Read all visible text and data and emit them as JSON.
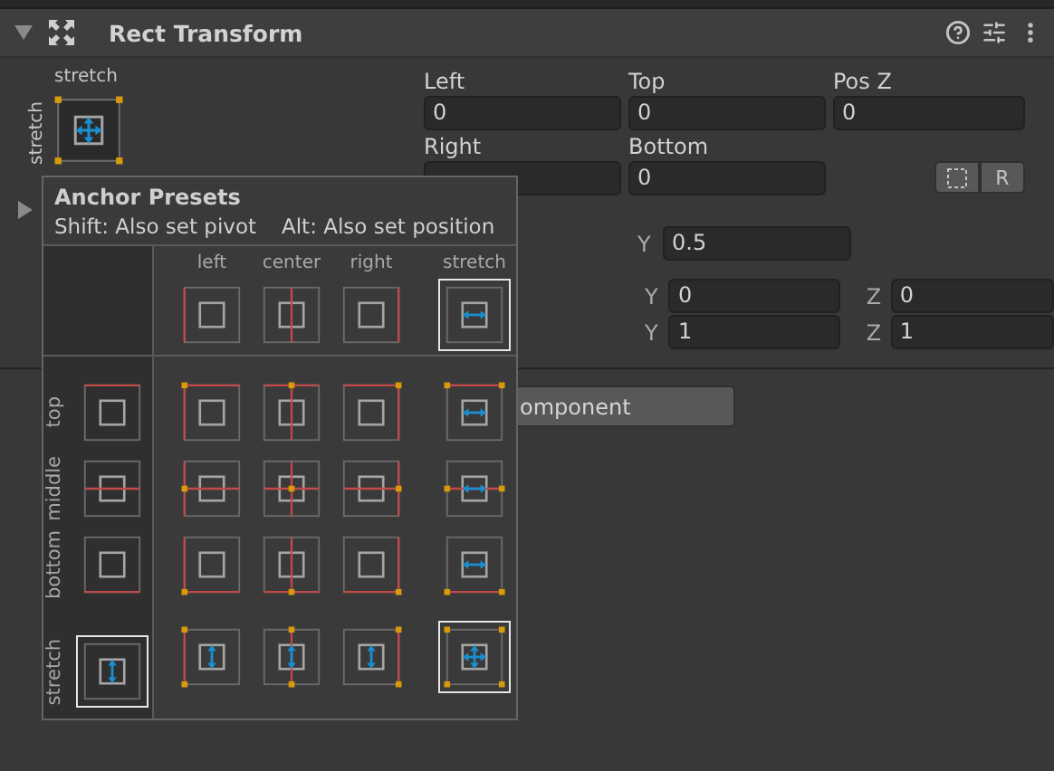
{
  "component": {
    "title": "Rect Transform",
    "expanded": true
  },
  "anchor": {
    "top_label": "stretch",
    "side_label": "stretch",
    "kind": "stretch_stretch"
  },
  "offset_fields": [
    {
      "label": "Left",
      "value": "0"
    },
    {
      "label": "Top",
      "value": "0"
    },
    {
      "label": "Pos Z",
      "value": "0"
    },
    {
      "label": "Right"
    },
    {
      "label": "Bottom",
      "value": "0"
    }
  ],
  "raw_button": "R",
  "pivot_row": [
    {
      "axis": "Y",
      "value": "0.5"
    }
  ],
  "rotation_row": [
    {
      "axis": "Y",
      "value": "0"
    },
    {
      "axis": "Z",
      "value": "0"
    }
  ],
  "scale_row": [
    {
      "axis": "Y",
      "value": "1"
    },
    {
      "axis": "Z",
      "value": "1"
    }
  ],
  "add_component_button": "omponent",
  "popup": {
    "title": "Anchor Presets",
    "hint_shift": "Shift: Also set pivot",
    "hint_alt": "Alt: Also set position",
    "columns": [
      {
        "label": "left",
        "kind": "left_none",
        "selected": false
      },
      {
        "label": "center",
        "kind": "center_none",
        "selected": false
      },
      {
        "label": "right",
        "kind": "right_none",
        "selected": false
      },
      {
        "label": "stretch",
        "kind": "stretch_none",
        "selected": true
      }
    ],
    "rows": [
      {
        "label": "top",
        "kind": "none_top",
        "selected": false,
        "cells": [
          {
            "kind": "left_top",
            "selected": false
          },
          {
            "kind": "center_top",
            "selected": false
          },
          {
            "kind": "right_top",
            "selected": false
          },
          {
            "kind": "stretch_top",
            "selected": false
          }
        ]
      },
      {
        "label": "middle",
        "kind": "none_middle",
        "selected": false,
        "cells": [
          {
            "kind": "left_middle",
            "selected": false
          },
          {
            "kind": "center_middle",
            "selected": false
          },
          {
            "kind": "right_middle",
            "selected": false
          },
          {
            "kind": "stretch_middle",
            "selected": false
          }
        ]
      },
      {
        "label": "bottom",
        "kind": "none_bottom",
        "selected": false,
        "cells": [
          {
            "kind": "left_bottom",
            "selected": false
          },
          {
            "kind": "center_bottom",
            "selected": false
          },
          {
            "kind": "right_bottom",
            "selected": false
          },
          {
            "kind": "stretch_bottom",
            "selected": false
          }
        ]
      },
      {
        "label": "stretch",
        "kind": "none_stretch",
        "selected": true,
        "cells": [
          {
            "kind": "left_stretch",
            "selected": false
          },
          {
            "kind": "center_stretch",
            "selected": false
          },
          {
            "kind": "right_stretch",
            "selected": false
          },
          {
            "kind": "stretch_stretch",
            "selected": true
          }
        ]
      }
    ]
  }
}
